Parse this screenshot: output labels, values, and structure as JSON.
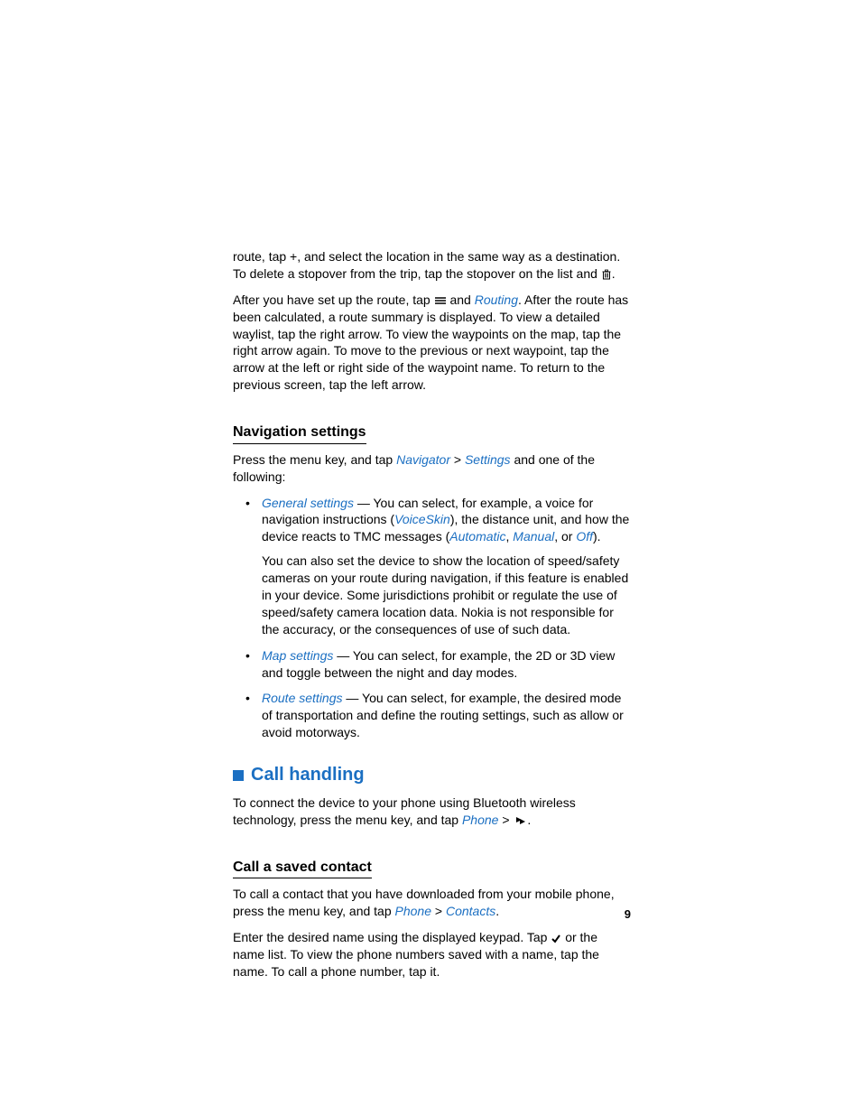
{
  "para1": {
    "t1": "route, tap ",
    "plus": "+",
    "t2": ", and select the location in the same way as a destination. To delete a stopover from the trip, tap the stopover on the list and ",
    "t3": "."
  },
  "para2": {
    "t1": "After you have set up the route, tap ",
    "t2": " and ",
    "link1": "Routing",
    "t3": ". After the route has been calculated, a route summary is displayed. To view a detailed waylist, tap the right arrow. To view the waypoints on the map, tap the right arrow again. To move to the previous or next waypoint, tap the arrow at the left or right side of the waypoint name. To return to the previous screen, tap the left arrow."
  },
  "nav_heading": "Navigation settings",
  "nav_intro": {
    "t1": "Press the menu key, and tap ",
    "link1": "Navigator",
    "sep": " > ",
    "link2": "Settings",
    "t2": " and one of the following:"
  },
  "bullets": {
    "b1": {
      "link": "General settings",
      "t1": " — You can select, for example, a voice for navigation instructions (",
      "link2": "VoiceSkin",
      "t2": "), the distance unit, and how the device reacts to TMC messages (",
      "link3": "Automatic",
      "comma1": ", ",
      "link4": "Manual",
      "comma2": ", or ",
      "link5": "Off",
      "t3": ").",
      "sub": "You can also set the device to show the location of speed/safety cameras on your route during navigation, if this feature is enabled in your device. Some jurisdictions prohibit or regulate the use of speed/safety camera location data. Nokia is not responsible for the accuracy, or the consequences of use of such data."
    },
    "b2": {
      "link": "Map settings",
      "t1": " — You can select, for example, the 2D or 3D view and toggle between the night and day modes."
    },
    "b3": {
      "link": "Route settings",
      "t1": " — You can select, for example, the desired mode of transportation and define the routing settings, such as allow or avoid motorways."
    }
  },
  "call_heading": "Call handling",
  "call_intro": {
    "t1": "To connect the device to your phone using Bluetooth wireless technology, press the menu key, and tap ",
    "link1": "Phone",
    "sep": " > ",
    "t2": "."
  },
  "contact_heading": "Call a saved contact",
  "contact_p1": {
    "t1": "To call a contact that you have downloaded from your mobile phone, press the menu key, and tap ",
    "link1": "Phone",
    "sep": " > ",
    "link2": "Contacts",
    "t2": "."
  },
  "contact_p2": {
    "t1": "Enter the desired name using the displayed keypad. Tap ",
    "t2": " or the name list. To view the phone numbers saved with a name, tap the name. To call a phone number, tap it."
  },
  "page_number": "9"
}
